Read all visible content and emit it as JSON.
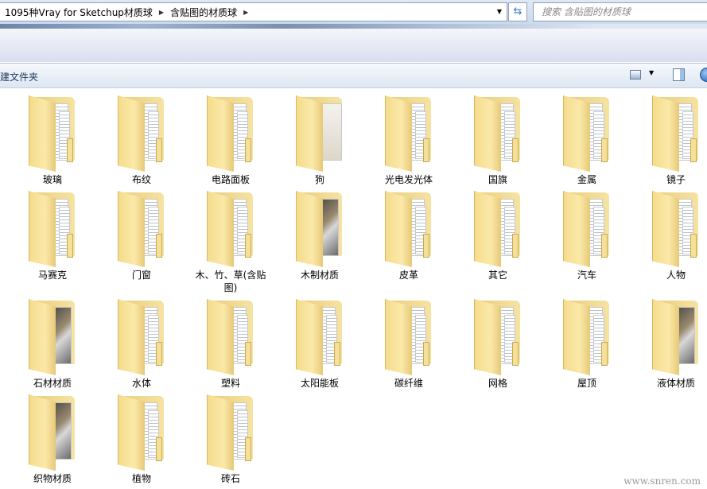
{
  "address": {
    "crumbs": [
      "1095种Vray for Sketchup材质球",
      "含贴图的材质球"
    ],
    "search_placeholder": "搜索 含贴图的材质球"
  },
  "toolbar": {
    "new_folder": "建文件夹"
  },
  "folders": [
    {
      "name": "玻璃",
      "preview": ""
    },
    {
      "name": "布纹",
      "preview": ""
    },
    {
      "name": "电路面板",
      "preview": ""
    },
    {
      "name": "狗",
      "preview": "dog"
    },
    {
      "name": "光电发光体",
      "preview": ""
    },
    {
      "name": "国旗",
      "preview": ""
    },
    {
      "name": "金属",
      "preview": ""
    },
    {
      "name": "镜子",
      "preview": ""
    },
    {
      "name": "马赛克",
      "preview": ""
    },
    {
      "name": "门窗",
      "preview": ""
    },
    {
      "name": "木、竹、草(含贴图)",
      "preview": ""
    },
    {
      "name": "木制材质",
      "preview": "sphere"
    },
    {
      "name": "皮革",
      "preview": ""
    },
    {
      "name": "其它",
      "preview": ""
    },
    {
      "name": "汽车",
      "preview": ""
    },
    {
      "name": "人物",
      "preview": ""
    },
    {
      "name": "石材材质",
      "preview": "sphere"
    },
    {
      "name": "水体",
      "preview": ""
    },
    {
      "name": "塑料",
      "preview": ""
    },
    {
      "name": "太阳能板",
      "preview": ""
    },
    {
      "name": "碳纤维",
      "preview": ""
    },
    {
      "name": "网格",
      "preview": ""
    },
    {
      "name": "屋顶",
      "preview": ""
    },
    {
      "name": "液体材质",
      "preview": "sphere"
    },
    {
      "name": "织物材质",
      "preview": "sphere"
    },
    {
      "name": "植物",
      "preview": ""
    },
    {
      "name": "砖石",
      "preview": ""
    }
  ],
  "watermark": "www.snren.com"
}
